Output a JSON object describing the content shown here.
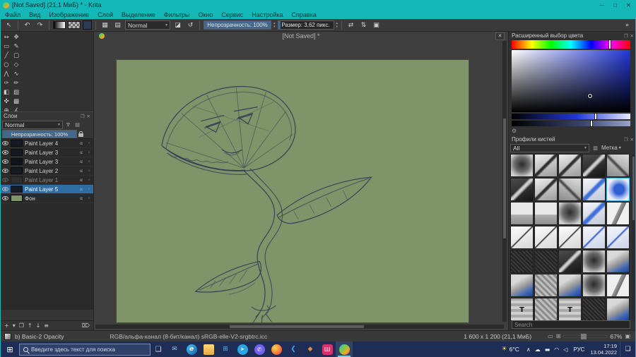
{
  "colors": {
    "accent_teal": "#14b8b9",
    "canvas_green": "#7f9468",
    "sketch_ink": "#2d3b55",
    "selection_blue": "#2e6ca4",
    "taskbar_navy": "#1e2d55"
  },
  "window": {
    "title": "[Not Saved] (21.1 МиБ) * - Krita",
    "minimize": "─",
    "maximize": "□",
    "close": "✕"
  },
  "menubar": {
    "items": [
      "Файл",
      "Вид",
      "Изображение",
      "Слой",
      "Выделение",
      "Фильтры",
      "Окно",
      "Сервис",
      "Настройка",
      "Справка"
    ]
  },
  "icons": {
    "pointer": "↖",
    "undo": "↶",
    "redo": "↷",
    "brush_settings": "▦",
    "preset_chooser": "▤",
    "eraser": "◪",
    "reload": "↺",
    "combo_arrow": "▾",
    "spin_up": "▴",
    "spin_down": "▾",
    "mirror_h": "⇄",
    "mirror_v": "⇅",
    "wrap": "▣",
    "overflow": "»",
    "float": "❐",
    "close": "✕",
    "funnel": "∇",
    "thumb_grid": "▤",
    "alpha": "α",
    "gear": "⚙",
    "doc_close": "✕",
    "fit_page": "▭",
    "fit_width": "⊞",
    "start": "⊞",
    "taskview": "❏",
    "notification": "❏",
    "sun": "☀",
    "tag_arrow": "▾",
    "view_list": "▥"
  },
  "toolbar": {
    "blending": "Normal",
    "opacity": "Непрозрачность: 100%",
    "size": "Размер: 3,62 пикс."
  },
  "toolbox": {
    "tools": [
      {
        "name": "transform-tool",
        "g": "↔"
      },
      {
        "name": "move-tool",
        "g": "✥"
      },
      {
        "name": "crop-tool",
        "g": "▭"
      },
      {
        "name": "freehand-brush-tool",
        "g": "✎"
      },
      {
        "name": "line-tool",
        "g": "╱"
      },
      {
        "name": "rectangle-tool",
        "g": "▢"
      },
      {
        "name": "ellipse-tool",
        "g": "○"
      },
      {
        "name": "polygon-tool",
        "g": "◇"
      },
      {
        "name": "polyline-tool",
        "g": "⋀"
      },
      {
        "name": "bezier-tool",
        "g": "∿"
      },
      {
        "name": "freehand-path-tool",
        "g": "✑"
      },
      {
        "name": "dynamic-brush-tool",
        "g": "✏"
      },
      {
        "name": "fill-tool",
        "g": "◧"
      },
      {
        "name": "gradient-tool",
        "g": "▧"
      },
      {
        "name": "color-sampler-tool",
        "g": "✜"
      },
      {
        "name": "pattern-tool",
        "g": "▩"
      },
      {
        "name": "zoom-tool",
        "g": "⊕"
      },
      {
        "name": "measure-tool",
        "g": "∡"
      }
    ]
  },
  "layers": {
    "title": "Слои",
    "blend": "Normal",
    "opacity": "Непрозрачность: 100%",
    "rows": [
      {
        "name": "Paint Layer 4",
        "cls": "",
        "thumb": "background:#161a22"
      },
      {
        "name": "Paint Layer 3",
        "cls": "",
        "thumb": "background:#161a22"
      },
      {
        "name": "Paint Layer 3",
        "cls": "",
        "thumb": "background:#11141c"
      },
      {
        "name": "Paint Layer 2",
        "cls": "",
        "thumb": "background:#161a22"
      },
      {
        "name": "Paint Layer 1",
        "cls": "dimmed",
        "thumb": "background:#3a3a3a"
      },
      {
        "name": "Paint Layer 5",
        "cls": "selected",
        "thumb": "background:#161a22"
      },
      {
        "name": "Фон",
        "cls": "",
        "thumb": "background:#7f9468"
      }
    ],
    "actions": [
      {
        "name": "add-layer-button",
        "g": "+"
      },
      {
        "name": "layer-type-arrow",
        "g": "▾"
      },
      {
        "name": "duplicate-layer-button",
        "g": "❐"
      },
      {
        "name": "move-layer-up-button",
        "g": "↑"
      },
      {
        "name": "move-layer-down-button",
        "g": "↓"
      },
      {
        "name": "layer-properties-button",
        "g": "≡"
      },
      {
        "name": "delete-layer-button",
        "g": "⌦"
      }
    ]
  },
  "canvas": {
    "doc_title": "[Not Saved] *"
  },
  "color_docker": {
    "title": "Расширенный выбор цвета"
  },
  "brush_docker": {
    "title": "Профили кистей",
    "filter_value": "All",
    "tag_label": "Метка",
    "search_placeholder": "Search",
    "tiles": [
      {
        "cls": "v-soft",
        "g": ""
      },
      {
        "cls": "v-pencil",
        "g": ""
      },
      {
        "cls": "v-pencil",
        "g": ""
      },
      {
        "cls": "v-dark",
        "g": ""
      },
      {
        "cls": "v-pencil2",
        "g": ""
      },
      {
        "cls": "v-dark",
        "g": ""
      },
      {
        "cls": "v-pencil",
        "g": ""
      },
      {
        "cls": "v-pencil2",
        "g": ""
      },
      {
        "cls": "v-blue",
        "g": ""
      },
      {
        "cls": "v-bluedot sel",
        "g": ""
      },
      {
        "cls": "v-eraser",
        "g": ""
      },
      {
        "cls": "v-eraser",
        "g": ""
      },
      {
        "cls": "v-soft",
        "g": ""
      },
      {
        "cls": "v-blue",
        "g": ""
      },
      {
        "cls": "v-knife",
        "g": ""
      },
      {
        "cls": "v-pen",
        "g": ""
      },
      {
        "cls": "v-pen",
        "g": ""
      },
      {
        "cls": "v-pen",
        "g": ""
      },
      {
        "cls": "v-penblue",
        "g": ""
      },
      {
        "cls": "v-penblue",
        "g": ""
      },
      {
        "cls": "v-charcoal",
        "g": ""
      },
      {
        "cls": "v-charcoal",
        "g": ""
      },
      {
        "cls": "v-dark",
        "g": ""
      },
      {
        "cls": "v-soft",
        "g": ""
      },
      {
        "cls": "v-brushblue",
        "g": ""
      },
      {
        "cls": "v-brushblue",
        "g": ""
      },
      {
        "cls": "v-tex",
        "g": ""
      },
      {
        "cls": "v-brushblue",
        "g": ""
      },
      {
        "cls": "v-soft",
        "g": ""
      },
      {
        "cls": "v-knife",
        "g": ""
      },
      {
        "cls": "v-texT",
        "g": "T"
      },
      {
        "cls": "v-tex",
        "g": ""
      },
      {
        "cls": "v-texT",
        "g": "T"
      },
      {
        "cls": "v-charcoal",
        "g": ""
      },
      {
        "cls": "v-brushblue",
        "g": ""
      }
    ]
  },
  "statusbar": {
    "preset": "b) Basic-2 Opacity",
    "profile": "RGB/альфа-канал (8-бит/канал)  sRGB-elle-V2-srgbtrc.icc",
    "dims": "1 600 x 1 200 (21,1 МиБ)",
    "zoom": "67%"
  },
  "taskbar": {
    "search_placeholder": "Введите здесь текст для поиска",
    "apps": [
      {
        "name": "taskbar-mail-icon",
        "g": "✉",
        "style": "color:#9ec3f0",
        "cls": ""
      },
      {
        "name": "taskbar-edge-icon",
        "g": "e",
        "style": "background:linear-gradient(135deg,#49c7f2,#0f5fae);color:#fff;border-radius:50%;font-style:italic;font-weight:bold",
        "cls": ""
      },
      {
        "name": "taskbar-explorer-icon",
        "g": "",
        "style": "background:linear-gradient(180deg,#ffd978,#e8a93c);border-radius:2px",
        "cls": ""
      },
      {
        "name": "taskbar-store-icon",
        "g": "⊞",
        "style": "color:#53b1f0",
        "cls": ""
      },
      {
        "name": "taskbar-telegram-icon",
        "g": "➤",
        "style": "background:#2ca5e0;color:#fff;border-radius:50%;font-size:7px",
        "cls": ""
      },
      {
        "name": "taskbar-viber-icon",
        "g": "✆",
        "style": "background:#7360f2;color:#fff;border-radius:50%;font-size:8px",
        "cls": ""
      },
      {
        "name": "taskbar-firefox-icon",
        "g": "",
        "style": "background:radial-gradient(circle at 35% 35%,#ffd54d,#ff7139 60%,#e3397a);border-radius:50%",
        "cls": ""
      },
      {
        "name": "taskbar-vscode-icon",
        "g": "❮",
        "style": "color:#3fa7f0;font-weight:bold",
        "cls": ""
      },
      {
        "name": "taskbar-app-orange-icon",
        "g": "◆",
        "style": "color:#e8883a",
        "cls": ""
      },
      {
        "name": "taskbar-app-pink-icon",
        "g": "Ш",
        "style": "background:#d6336c;color:#fff;border-radius:3px;font-size:8px",
        "cls": ""
      },
      {
        "name": "taskbar-krita-icon",
        "g": "",
        "style": "background:linear-gradient(135deg,#29c5e3,#7ac943 40%,#f5a623 70%,#e84c8b);border-radius:50%",
        "cls": "active"
      }
    ],
    "weather_temp": "6°C",
    "tray": [
      {
        "name": "tray-chevron-icon",
        "g": "∧"
      },
      {
        "name": "onedrive-icon",
        "g": "☁"
      },
      {
        "name": "battery-icon",
        "g": "▬"
      },
      {
        "name": "network-icon",
        "g": "◠"
      },
      {
        "name": "volume-icon",
        "g": "◁"
      }
    ],
    "lang": "РУС",
    "time": "17:19",
    "date": "13.04.2022"
  }
}
